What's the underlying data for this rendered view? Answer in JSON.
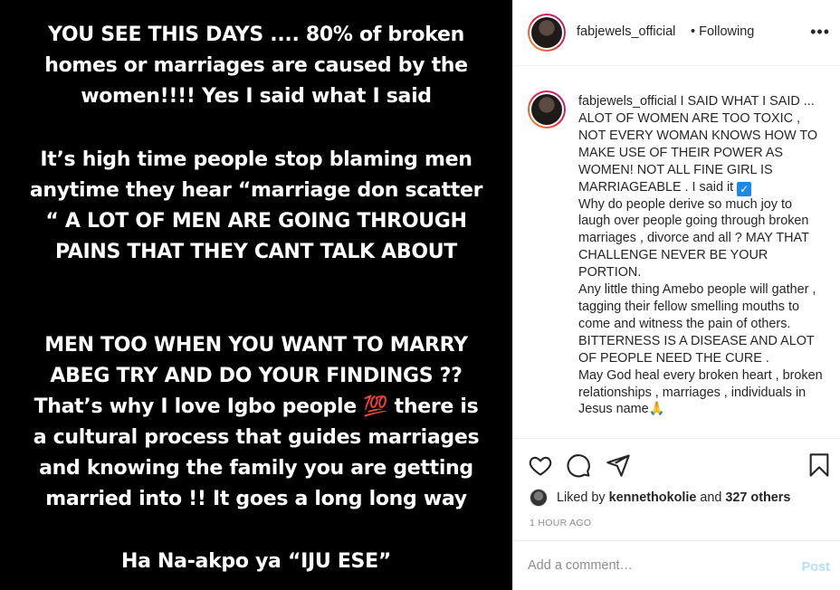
{
  "post_image": {
    "lines_p1": [
      "YOU SEE THIS DAYS .... 80% of broken",
      "homes or marriages are caused by the",
      "women!!!!  Yes I said what I said"
    ],
    "lines_p2": [
      "It’s high time people stop blaming men",
      "anytime they hear “marriage don scatter",
      "“ A LOT OF MEN ARE GOING THROUGH",
      "PAINS THAT THEY CANT TALK ABOUT"
    ],
    "lines_p3": [
      "MEN TOO WHEN YOU WANT TO MARRY",
      "ABEG TRY AND DO YOUR FINDINGS ??",
      "That’s why I love Igbo people 💯 there is",
      "a cultural process that guides marriages",
      "and knowing the family you are getting",
      "married into !! It goes a long long way"
    ],
    "lines_p4": [
      "Ha Na-akpo ya “IJU ESE”"
    ]
  },
  "header": {
    "username": "fabjewels_official",
    "following": "• Following",
    "more": "•••"
  },
  "caption": {
    "username": "fabjewels_official",
    "text_before_check": " I SAID WHAT I SAID ... ALOT OF WOMEN ARE TOO TOXIC , NOT EVERY WOMAN KNOWS HOW TO MAKE USE OF THEIR POWER AS WOMEN! NOT ALL FINE GIRL IS MARRIAGEABLE . I said it ",
    "check": "✓",
    "text_after_check": "Why do people derive so much joy to laugh over people going through broken marriages , divorce and all ? MAY THAT CHALLENGE NEVER BE YOUR PORTION.",
    "text_p3": "Any little thing Amebo people will gather , tagging their fellow smelling mouths to come and witness the pain of others.",
    "text_p4": "BITTERNESS IS A DISEASE AND ALOT OF PEOPLE NEED THE CURE .",
    "text_p5": "May God heal every broken heart , broken relationships , marriages , individuals in Jesus name🙏"
  },
  "icons": {
    "like": "heart-icon",
    "comment": "comment-icon",
    "share": "paper-plane-icon",
    "save": "bookmark-icon"
  },
  "likes": {
    "prefix": "Liked by ",
    "user": "kennethokolie",
    "middle": " and ",
    "others": "327 others"
  },
  "timestamp": "1 HOUR AGO",
  "comment_box": {
    "placeholder": "Add a comment…",
    "post_label": "Post"
  }
}
